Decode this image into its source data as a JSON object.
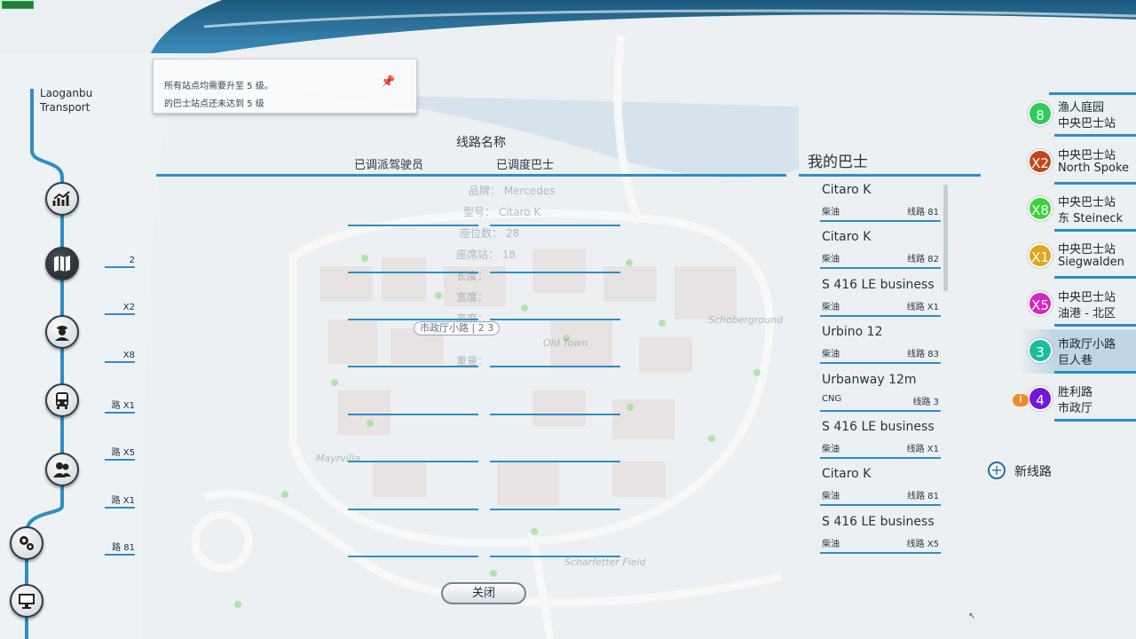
{
  "company": {
    "line1": "Laoganbu",
    "line2": "Transport"
  },
  "notification": {
    "line1": "所有站点均需要升至 5 级。",
    "line2": "的巴士站点还未达到 5 级"
  },
  "center": {
    "title": "线路名称",
    "col_drivers": "已调派驾驶员",
    "col_buses": "已调度巴士",
    "close_label": "关闭",
    "ghost_text": [
      "品牌： Mercedes",
      "型号： Citaro K",
      "座位数： 28",
      "座席站： 18",
      "长度：",
      "宽度：",
      "高度：",
      "重量：",
      "Schoberground",
      "Old Town",
      "Mayrvilla",
      "Scharfetter Field"
    ]
  },
  "left_stub_routes": [
    "2",
    "X2",
    "X8",
    "路 X1",
    "路 X5",
    "路 X1",
    "路 81"
  ],
  "my_bus": {
    "title": "我的巴士",
    "items": [
      {
        "name": "Citaro K",
        "fuel": "柴油",
        "route": "线路 81"
      },
      {
        "name": "Citaro K",
        "fuel": "柴油",
        "route": "线路 82"
      },
      {
        "name": "S 416 LE business",
        "fuel": "柴油",
        "route": "线路 X1"
      },
      {
        "name": "Urbino 12",
        "fuel": "柴油",
        "route": "线路 83"
      },
      {
        "name": "Urbanway 12m",
        "fuel": "CNG",
        "route": "线路 3"
      },
      {
        "name": "S 416 LE business",
        "fuel": "柴油",
        "route": "线路 X1"
      },
      {
        "name": "Citaro K",
        "fuel": "柴油",
        "route": "线路 81"
      },
      {
        "name": "S 416 LE business",
        "fuel": "柴油",
        "route": "线路 X5"
      }
    ]
  },
  "routes": [
    {
      "number": "8",
      "color": "#2ecc5a",
      "stop1": "渔人庭园",
      "stop2": "中央巴士站"
    },
    {
      "number": "X2",
      "color": "#c4461b",
      "stop1": "中央巴士站",
      "stop2": "North Spoke"
    },
    {
      "number": "X8",
      "color": "#3fd13b",
      "stop1": "中央巴士站",
      "stop2": "东 Steineck"
    },
    {
      "number": "X1",
      "color": "#e0a61c",
      "stop1": "中央巴士站",
      "stop2": "Siegwalden"
    },
    {
      "number": "X5",
      "color": "#d428c2",
      "stop1": "中央巴士站",
      "stop2": "油港 - 北区"
    },
    {
      "number": "3",
      "color": "#19bf9c",
      "stop1": "市政厅小路",
      "stop2": "巨人巷"
    },
    {
      "number": "4",
      "color": "#7417d8",
      "stop1": "胜利路",
      "stop2": "市政厅"
    }
  ],
  "new_route_label": "新线路",
  "map_label": "市政厅小路 | 2 3",
  "colors": {
    "accent": "#2b8fc5",
    "dark": "#1e2a33"
  }
}
